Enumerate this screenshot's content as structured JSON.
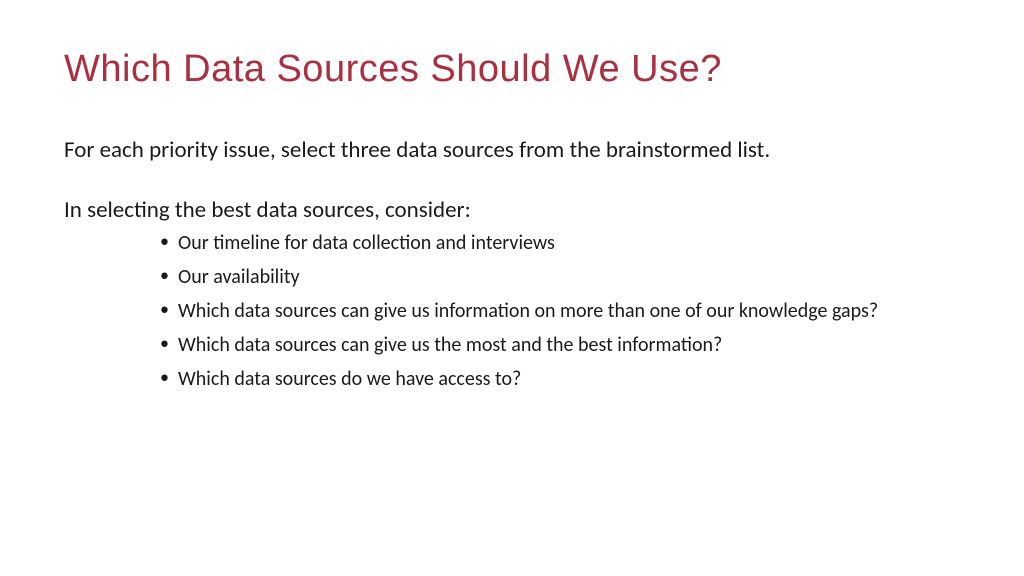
{
  "title": "Which Data Sources Should We Use?",
  "intro": "For each priority issue, select three data sources from the brainstormed list.",
  "considerLabel": "In selecting the best data sources, consider:",
  "bullets": [
    "Our timeline for data collection and interviews",
    "Our availability",
    "Which data sources can give us information on more than one of our knowledge gaps?",
    "Which data sources can give us the most and the best information?",
    "Which data sources do we have access to?"
  ]
}
